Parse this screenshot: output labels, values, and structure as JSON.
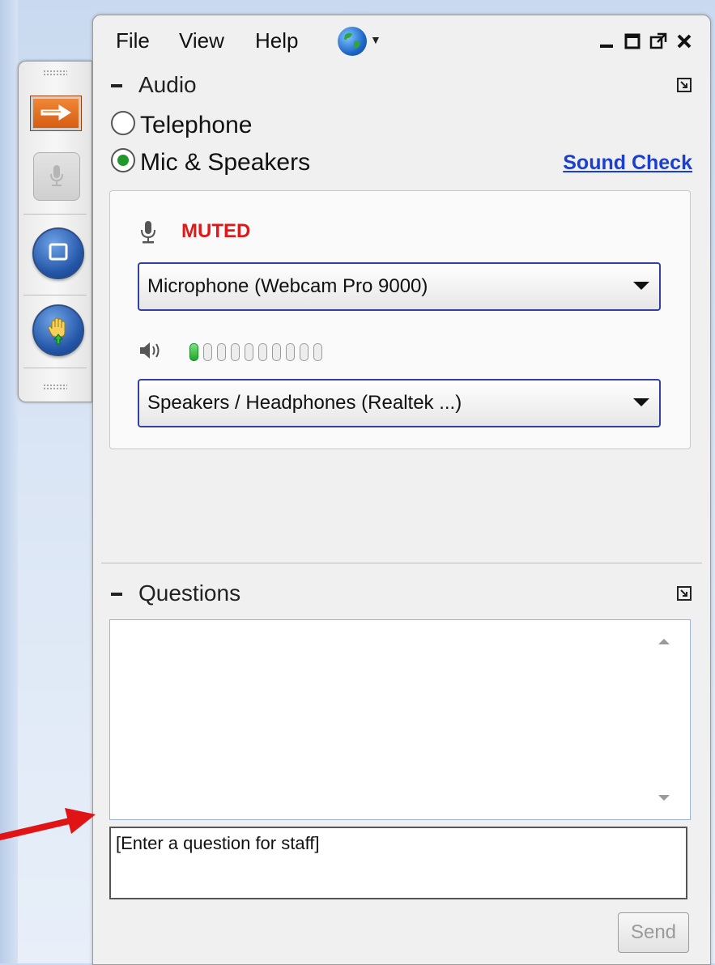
{
  "menubar": {
    "items": [
      "File",
      "View",
      "Help"
    ],
    "language_icon": "globe-icon",
    "window_controls": [
      "minimize-icon",
      "maximize-icon",
      "popout-icon",
      "close-icon"
    ]
  },
  "sidebar": {
    "buttons": [
      "arrow-right-icon",
      "microphone-icon",
      "square-icon",
      "raise-hand-icon"
    ]
  },
  "audio": {
    "title": "Audio",
    "options": [
      "Telephone",
      "Mic & Speakers"
    ],
    "selected": "Mic & Speakers",
    "sound_check": "Sound Check",
    "mic_status": "MUTED",
    "microphone": "Microphone (Webcam Pro 9000)",
    "speaker_level": {
      "total_segments": 10,
      "active_segments": 1
    },
    "speakers": "Speakers / Headphones (Realtek ...)"
  },
  "questions": {
    "title": "Questions",
    "log": "",
    "input_value": "[Enter a question for staff]",
    "send": "Send"
  },
  "colors": {
    "muted": "#e01818",
    "link": "#1a3fd1",
    "accent": "#d45a10",
    "annotation_arrow": "#e01414"
  }
}
